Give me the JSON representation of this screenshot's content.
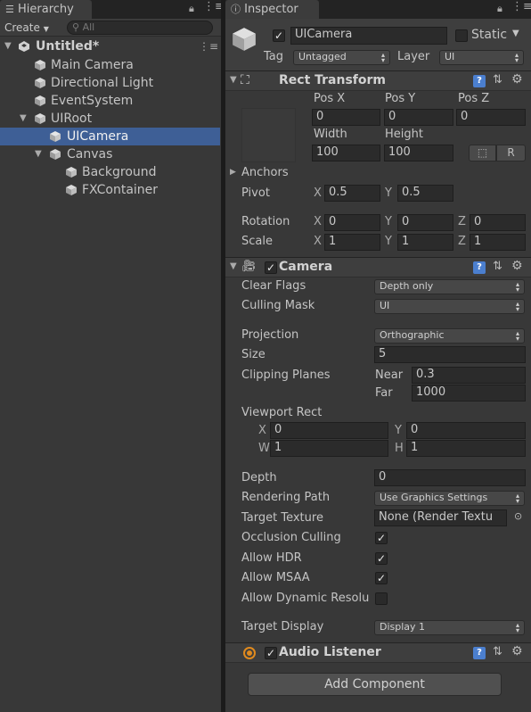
{
  "hierarchy": {
    "tab_label": "Hierarchy",
    "create_label": "Create",
    "search_placeholder": "All",
    "scene_name": "Untitled*",
    "items": [
      {
        "label": "Main Camera"
      },
      {
        "label": "Directional Light"
      },
      {
        "label": "EventSystem"
      },
      {
        "label": "UIRoot"
      },
      {
        "label": "UICamera"
      },
      {
        "label": "Canvas"
      },
      {
        "label": "Background"
      },
      {
        "label": "FXContainer"
      }
    ]
  },
  "inspector": {
    "tab_label": "Inspector",
    "object_name": "UICamera",
    "static_label": "Static",
    "tag_label": "Tag",
    "tag_value": "Untagged",
    "layer_label": "Layer",
    "layer_value": "UI",
    "rect_transform": {
      "title": "Rect Transform",
      "pos_x_label": "Pos X",
      "pos_y_label": "Pos Y",
      "pos_z_label": "Pos Z",
      "pos_x": "0",
      "pos_y": "0",
      "pos_z": "0",
      "width_label": "Width",
      "height_label": "Height",
      "width": "100",
      "height": "100",
      "r_button": "R",
      "anchors_label": "Anchors",
      "pivot_label": "Pivot",
      "pivot_x": "0.5",
      "pivot_y": "0.5",
      "rotation_label": "Rotation",
      "rot_x": "0",
      "rot_y": "0",
      "rot_z": "0",
      "scale_label": "Scale",
      "scale_x": "1",
      "scale_y": "1",
      "scale_z": "1",
      "x": "X",
      "y": "Y",
      "z": "Z"
    },
    "camera": {
      "title": "Camera",
      "clear_flags_label": "Clear Flags",
      "clear_flags": "Depth only",
      "culling_mask_label": "Culling Mask",
      "culling_mask": "UI",
      "projection_label": "Projection",
      "projection": "Orthographic",
      "size_label": "Size",
      "size": "5",
      "clipping_label": "Clipping Planes",
      "near_label": "Near",
      "near": "0.3",
      "far_label": "Far",
      "far": "1000",
      "viewport_label": "Viewport Rect",
      "vx_label": "X",
      "vx": "0",
      "vy_label": "Y",
      "vy": "0",
      "vw_label": "W",
      "vw": "1",
      "vh_label": "H",
      "vh": "1",
      "depth_label": "Depth",
      "depth": "0",
      "rendering_path_label": "Rendering Path",
      "rendering_path": "Use Graphics Settings",
      "target_texture_label": "Target Texture",
      "target_texture": "None (Render Textu",
      "occlusion_label": "Occlusion Culling",
      "hdr_label": "Allow HDR",
      "msaa_label": "Allow MSAA",
      "dynres_label": "Allow Dynamic Resolu",
      "target_display_label": "Target Display",
      "target_display": "Display 1",
      "occlusion_checked": true,
      "hdr_checked": true,
      "msaa_checked": true,
      "dynres_checked": false
    },
    "audio_listener": {
      "title": "Audio Listener"
    },
    "add_component_label": "Add Component"
  },
  "colors": {
    "selection": "#3e5f96",
    "panel": "#383838",
    "section_header": "#3e3e3e",
    "help_icon": "#4b7fcf"
  }
}
